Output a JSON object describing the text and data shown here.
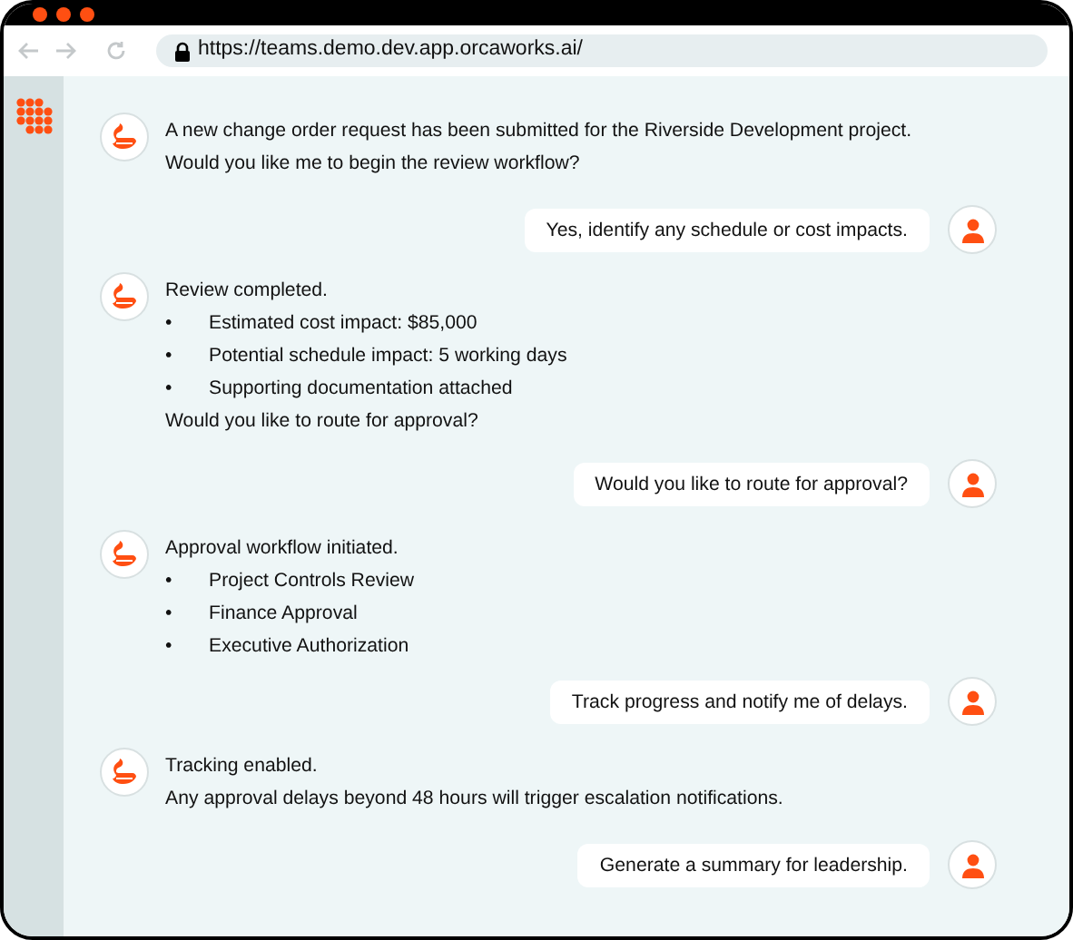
{
  "browser": {
    "url": "https://teams.demo.dev.app.orcaworks.ai/"
  },
  "messages": [
    {
      "kind": "bot",
      "body": [
        {
          "kind": "text",
          "text": "A new change order request has been submitted for the Riverside Development project."
        },
        {
          "kind": "text",
          "text": "Would you like me to begin the review workflow?"
        }
      ]
    },
    {
      "kind": "user",
      "text": "Yes, identify any schedule or cost impacts."
    },
    {
      "kind": "bot",
      "body": [
        {
          "kind": "text",
          "text": "Review completed."
        },
        {
          "kind": "bullet",
          "marker": "•",
          "text": "Estimated cost impact: $85,000"
        },
        {
          "kind": "bullet",
          "marker": "•",
          "text": "Potential schedule impact: 5 working days"
        },
        {
          "kind": "bullet",
          "marker": "•",
          "text": "Supporting documentation attached"
        },
        {
          "kind": "text",
          "text": "Would you like to route for approval?"
        }
      ]
    },
    {
      "kind": "user",
      "text": "Would you like to route for approval?"
    },
    {
      "kind": "bot",
      "body": [
        {
          "kind": "text",
          "text": "Approval workflow initiated."
        },
        {
          "kind": "bullet",
          "marker": "•",
          "text": "Project Controls Review"
        },
        {
          "kind": "bullet",
          "marker": "•",
          "text": "Finance Approval"
        },
        {
          "kind": "bullet",
          "marker": "•",
          "text": "Executive Authorization"
        }
      ]
    },
    {
      "kind": "user",
      "text": "Track progress and notify me of delays."
    },
    {
      "kind": "bot",
      "body": [
        {
          "kind": "text",
          "text": "Tracking enabled."
        },
        {
          "kind": "text",
          "text": "Any approval delays beyond 48 hours will trigger escalation notifications."
        }
      ]
    },
    {
      "kind": "user",
      "text": "Generate a summary for leadership."
    }
  ]
}
